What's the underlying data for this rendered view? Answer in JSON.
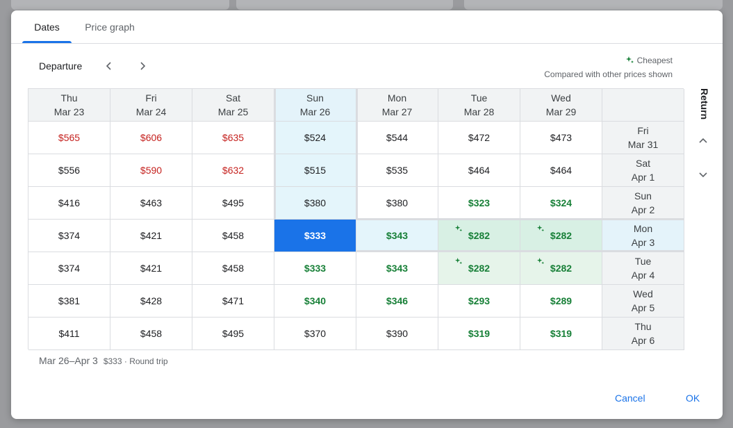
{
  "tabs": [
    {
      "label": "Dates",
      "active": true
    },
    {
      "label": "Price graph",
      "active": false
    }
  ],
  "departure_label": "Departure",
  "legend": {
    "title": "Cheapest",
    "subtitle": "Compared with other prices shown"
  },
  "return_label": "Return",
  "columns": [
    {
      "day": "Thu",
      "date": "Mar 23"
    },
    {
      "day": "Fri",
      "date": "Mar 24"
    },
    {
      "day": "Sat",
      "date": "Mar 25"
    },
    {
      "day": "Sun",
      "date": "Mar 26",
      "selected": true
    },
    {
      "day": "Mon",
      "date": "Mar 27"
    },
    {
      "day": "Tue",
      "date": "Mar 28"
    },
    {
      "day": "Wed",
      "date": "Mar 29"
    }
  ],
  "rows": [
    {
      "day": "Fri",
      "date": "Mar 31",
      "prices": [
        {
          "v": "$565",
          "c": "red"
        },
        {
          "v": "$606",
          "c": "red"
        },
        {
          "v": "$635",
          "c": "red"
        },
        {
          "v": "$524"
        },
        {
          "v": "$544"
        },
        {
          "v": "$472"
        },
        {
          "v": "$473"
        }
      ]
    },
    {
      "day": "Sat",
      "date": "Apr 1",
      "prices": [
        {
          "v": "$556"
        },
        {
          "v": "$590",
          "c": "red"
        },
        {
          "v": "$632",
          "c": "red"
        },
        {
          "v": "$515"
        },
        {
          "v": "$535"
        },
        {
          "v": "$464"
        },
        {
          "v": "$464"
        }
      ]
    },
    {
      "day": "Sun",
      "date": "Apr 2",
      "prices": [
        {
          "v": "$416"
        },
        {
          "v": "$463"
        },
        {
          "v": "$495"
        },
        {
          "v": "$380"
        },
        {
          "v": "$380"
        },
        {
          "v": "$323",
          "c": "green"
        },
        {
          "v": "$324",
          "c": "green"
        }
      ]
    },
    {
      "day": "Mon",
      "date": "Apr 3",
      "selected": true,
      "prices": [
        {
          "v": "$374"
        },
        {
          "v": "$421"
        },
        {
          "v": "$458"
        },
        {
          "v": "$333",
          "selected": true
        },
        {
          "v": "$343",
          "c": "green"
        },
        {
          "v": "$282",
          "c": "green",
          "cheapest": true
        },
        {
          "v": "$282",
          "c": "green",
          "cheapest": true
        }
      ]
    },
    {
      "day": "Tue",
      "date": "Apr 4",
      "prices": [
        {
          "v": "$374"
        },
        {
          "v": "$421"
        },
        {
          "v": "$458"
        },
        {
          "v": "$333",
          "c": "green"
        },
        {
          "v": "$343",
          "c": "green"
        },
        {
          "v": "$282",
          "c": "green",
          "cheapest": true
        },
        {
          "v": "$282",
          "c": "green",
          "cheapest": true
        }
      ]
    },
    {
      "day": "Wed",
      "date": "Apr 5",
      "prices": [
        {
          "v": "$381"
        },
        {
          "v": "$428"
        },
        {
          "v": "$471"
        },
        {
          "v": "$340",
          "c": "green"
        },
        {
          "v": "$346",
          "c": "green"
        },
        {
          "v": "$293",
          "c": "green"
        },
        {
          "v": "$289",
          "c": "green"
        }
      ]
    },
    {
      "day": "Thu",
      "date": "Apr 6",
      "prices": [
        {
          "v": "$411"
        },
        {
          "v": "$458"
        },
        {
          "v": "$495"
        },
        {
          "v": "$370"
        },
        {
          "v": "$390"
        },
        {
          "v": "$319",
          "c": "green"
        },
        {
          "v": "$319",
          "c": "green"
        }
      ]
    }
  ],
  "summary": {
    "dates": "Mar 26–Apr 3",
    "price_info": "$333 · Round trip"
  },
  "buttons": {
    "cancel": "Cancel",
    "ok": "OK"
  },
  "colors": {
    "accent": "#1a73e8",
    "expensive": "#c5221f",
    "cheap": "#188038"
  },
  "icons": {
    "prev": "chevron-left-icon",
    "next": "chevron-right-icon",
    "up": "chevron-up-icon",
    "down": "chevron-down-icon",
    "cheapest": "sparkle-icon"
  }
}
